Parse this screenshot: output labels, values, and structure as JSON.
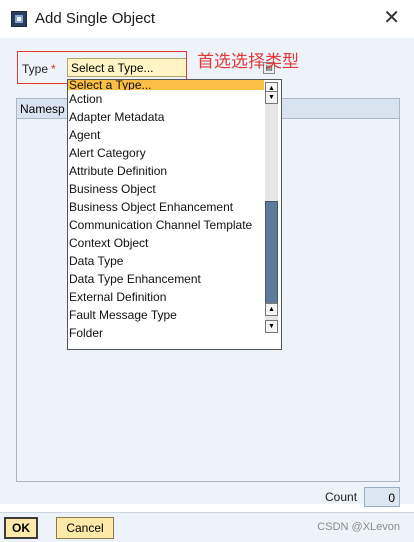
{
  "window": {
    "title": "Add Single Object",
    "icon": "sap-dialog-icon",
    "close_icon": "close-icon"
  },
  "form": {
    "type_label": "Type",
    "required_marker": "*",
    "type_value": "Select a Type..."
  },
  "annotation_text": "首选选择类型",
  "annotation_color": "#e03a3a",
  "table": {
    "header": "Namesp"
  },
  "dropdown": {
    "options": [
      "Select a Type...",
      "Action",
      "Adapter Metadata",
      "Agent",
      "Alert Category",
      "Attribute Definition",
      "Business Object",
      "Business Object Enhancement",
      "Communication Channel Template",
      "Context Object",
      "Data Type",
      "Data Type Enhancement",
      "External Definition",
      "Fault Message Type",
      "Folder"
    ],
    "selected_index": 0,
    "highlight_color": "#fbbf45"
  },
  "count": {
    "label": "Count",
    "value": "0"
  },
  "buttons": {
    "ok": "OK",
    "cancel": "Cancel"
  },
  "watermark": "CSDN @XLevon"
}
